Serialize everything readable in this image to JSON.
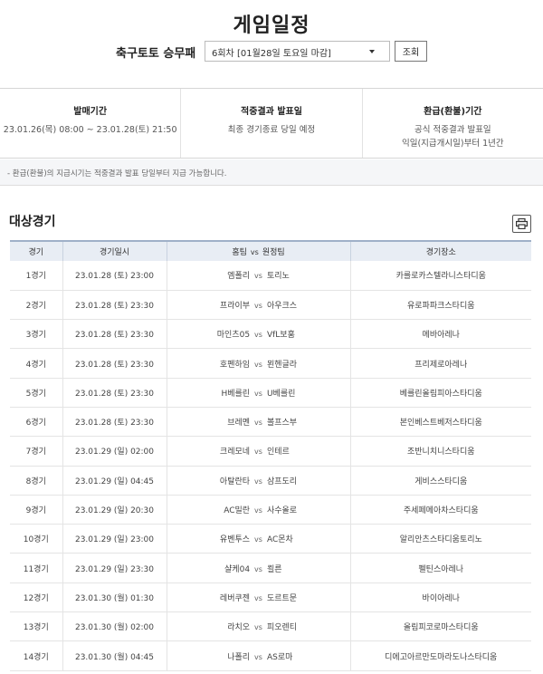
{
  "page_title": "게임일정",
  "selector": {
    "game_name": "축구토토 승무패",
    "selected_round": "6회차 [01월28일 토요일 마감]",
    "search_label": "조회"
  },
  "info": [
    {
      "head": "발매기간",
      "lines": [
        "23.01.26(목) 08:00 ~ 23.01.28(토) 21:50"
      ]
    },
    {
      "head": "적중결과 발표일",
      "lines": [
        "최종 경기종료 당일 예정"
      ]
    },
    {
      "head": "환급(환불)기간",
      "lines": [
        "공식 적중결과 발표일",
        "익일(지급개시일)부터 1년간"
      ]
    }
  ],
  "notice": "- 환급(환불)의 지급시기는 적중결과 발표 당일부터 지급 가능합니다.",
  "section_title": "대상경기",
  "icons": {
    "print": "print-icon",
    "dropdown": "chevron-down-icon"
  },
  "table": {
    "headers": {
      "no": "경기",
      "datetime": "경기일시",
      "home": "홈팀",
      "vs": "vs",
      "away": "원정팀",
      "venue": "경기장소"
    },
    "rows": [
      {
        "no": "1경기",
        "datetime": "23.01.28 (토) 23:00",
        "home": "엠폴리",
        "vs": "vs",
        "away": "토리노",
        "venue": "카를로카스텔라니스타디움"
      },
      {
        "no": "2경기",
        "datetime": "23.01.28 (토) 23:30",
        "home": "프라이부",
        "vs": "vs",
        "away": "아우크스",
        "venue": "유로파파크스타디움"
      },
      {
        "no": "3경기",
        "datetime": "23.01.28 (토) 23:30",
        "home": "마인츠05",
        "vs": "vs",
        "away": "VfL보훔",
        "venue": "메바아레나"
      },
      {
        "no": "4경기",
        "datetime": "23.01.28 (토) 23:30",
        "home": "호펜하임",
        "vs": "vs",
        "away": "묀헨글라",
        "venue": "프리제로아레나"
      },
      {
        "no": "5경기",
        "datetime": "23.01.28 (토) 23:30",
        "home": "H베를린",
        "vs": "vs",
        "away": "U베를린",
        "venue": "베를린올림피아스타디움"
      },
      {
        "no": "6경기",
        "datetime": "23.01.28 (토) 23:30",
        "home": "브레멘",
        "vs": "vs",
        "away": "볼프스부",
        "venue": "본인베스트베저스타디움"
      },
      {
        "no": "7경기",
        "datetime": "23.01.29 (일) 02:00",
        "home": "크레모네",
        "vs": "vs",
        "away": "인테르",
        "venue": "조반니치니스타디움"
      },
      {
        "no": "8경기",
        "datetime": "23.01.29 (일) 04:45",
        "home": "아탈란타",
        "vs": "vs",
        "away": "삼프도리",
        "venue": "게비스스타디움"
      },
      {
        "no": "9경기",
        "datetime": "23.01.29 (일) 20:30",
        "home": "AC밀란",
        "vs": "vs",
        "away": "사수올로",
        "venue": "주세페메아차스타디움"
      },
      {
        "no": "10경기",
        "datetime": "23.01.29 (일) 23:00",
        "home": "유벤투스",
        "vs": "vs",
        "away": "AC몬차",
        "venue": "알리안츠스타디움토리노"
      },
      {
        "no": "11경기",
        "datetime": "23.01.29 (일) 23:30",
        "home": "샬케04",
        "vs": "vs",
        "away": "쾰른",
        "venue": "펠틴스아레나"
      },
      {
        "no": "12경기",
        "datetime": "23.01.30 (월) 01:30",
        "home": "레버쿠젠",
        "vs": "vs",
        "away": "도르트문",
        "venue": "바이아레나"
      },
      {
        "no": "13경기",
        "datetime": "23.01.30 (월) 02:00",
        "home": "라치오",
        "vs": "vs",
        "away": "피오렌티",
        "venue": "올림피코로마스타디움"
      },
      {
        "no": "14경기",
        "datetime": "23.01.30 (월) 04:45",
        "home": "나폴리",
        "vs": "vs",
        "away": "AS로마",
        "venue": "디에고아르만도마라도나스타디움"
      }
    ]
  }
}
